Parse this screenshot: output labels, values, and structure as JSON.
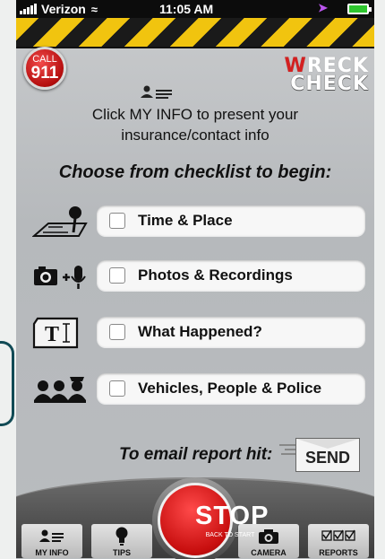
{
  "status_bar": {
    "carrier": "Verizon",
    "time": "11:05 AM"
  },
  "header": {
    "call_button": {
      "line1": "CALL",
      "line2": "911"
    },
    "logo": {
      "line1_accent": "W",
      "line1_rest": "RECK",
      "line2": "CHECK"
    }
  },
  "intro": {
    "line1": "Click MY INFO to present your",
    "line2": "insurance/contact info"
  },
  "checklist": {
    "heading": "Choose from checklist to begin:",
    "items": [
      {
        "label": "Time & Place",
        "icon": "map-pin-icon"
      },
      {
        "label": "Photos & Recordings",
        "icon": "camera-mic-icon"
      },
      {
        "label": "What Happened?",
        "icon": "text-edit-icon"
      },
      {
        "label": "Vehicles, People & Police",
        "icon": "people-police-icon"
      }
    ]
  },
  "email": {
    "prompt": "To email report hit:",
    "send_label": "SEND"
  },
  "tabbar": {
    "stop": {
      "main": "STOP",
      "sub": "BACK TO START"
    },
    "tabs": [
      {
        "label": "MY INFO",
        "icon": "id-card-icon"
      },
      {
        "label": "TIPS",
        "icon": "lightbulb-icon"
      },
      {
        "label": "CAMERA",
        "icon": "camera-icon"
      },
      {
        "label": "REPORTS",
        "icon": "checklist-icon"
      }
    ]
  },
  "colors": {
    "hazard_yellow": "#f1c40f",
    "alert_red": "#c70e0e",
    "background_gray": "#b9bcbf"
  }
}
